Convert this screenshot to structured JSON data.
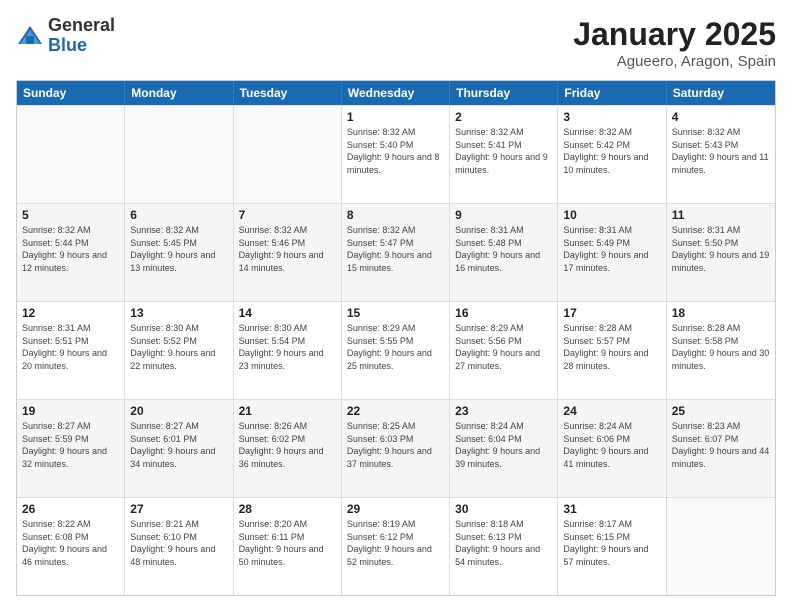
{
  "logo": {
    "general": "General",
    "blue": "Blue"
  },
  "title": "January 2025",
  "subtitle": "Agueero, Aragon, Spain",
  "days_of_week": [
    "Sunday",
    "Monday",
    "Tuesday",
    "Wednesday",
    "Thursday",
    "Friday",
    "Saturday"
  ],
  "weeks": [
    [
      {
        "day": "",
        "info": "",
        "empty": true
      },
      {
        "day": "",
        "info": "",
        "empty": true
      },
      {
        "day": "",
        "info": "",
        "empty": true
      },
      {
        "day": "1",
        "info": "Sunrise: 8:32 AM\nSunset: 5:40 PM\nDaylight: 9 hours and 8 minutes."
      },
      {
        "day": "2",
        "info": "Sunrise: 8:32 AM\nSunset: 5:41 PM\nDaylight: 9 hours and 9 minutes."
      },
      {
        "day": "3",
        "info": "Sunrise: 8:32 AM\nSunset: 5:42 PM\nDaylight: 9 hours and 10 minutes."
      },
      {
        "day": "4",
        "info": "Sunrise: 8:32 AM\nSunset: 5:43 PM\nDaylight: 9 hours and 11 minutes."
      }
    ],
    [
      {
        "day": "5",
        "info": "Sunrise: 8:32 AM\nSunset: 5:44 PM\nDaylight: 9 hours and 12 minutes."
      },
      {
        "day": "6",
        "info": "Sunrise: 8:32 AM\nSunset: 5:45 PM\nDaylight: 9 hours and 13 minutes."
      },
      {
        "day": "7",
        "info": "Sunrise: 8:32 AM\nSunset: 5:46 PM\nDaylight: 9 hours and 14 minutes."
      },
      {
        "day": "8",
        "info": "Sunrise: 8:32 AM\nSunset: 5:47 PM\nDaylight: 9 hours and 15 minutes."
      },
      {
        "day": "9",
        "info": "Sunrise: 8:31 AM\nSunset: 5:48 PM\nDaylight: 9 hours and 16 minutes."
      },
      {
        "day": "10",
        "info": "Sunrise: 8:31 AM\nSunset: 5:49 PM\nDaylight: 9 hours and 17 minutes."
      },
      {
        "day": "11",
        "info": "Sunrise: 8:31 AM\nSunset: 5:50 PM\nDaylight: 9 hours and 19 minutes."
      }
    ],
    [
      {
        "day": "12",
        "info": "Sunrise: 8:31 AM\nSunset: 5:51 PM\nDaylight: 9 hours and 20 minutes."
      },
      {
        "day": "13",
        "info": "Sunrise: 8:30 AM\nSunset: 5:52 PM\nDaylight: 9 hours and 22 minutes."
      },
      {
        "day": "14",
        "info": "Sunrise: 8:30 AM\nSunset: 5:54 PM\nDaylight: 9 hours and 23 minutes."
      },
      {
        "day": "15",
        "info": "Sunrise: 8:29 AM\nSunset: 5:55 PM\nDaylight: 9 hours and 25 minutes."
      },
      {
        "day": "16",
        "info": "Sunrise: 8:29 AM\nSunset: 5:56 PM\nDaylight: 9 hours and 27 minutes."
      },
      {
        "day": "17",
        "info": "Sunrise: 8:28 AM\nSunset: 5:57 PM\nDaylight: 9 hours and 28 minutes."
      },
      {
        "day": "18",
        "info": "Sunrise: 8:28 AM\nSunset: 5:58 PM\nDaylight: 9 hours and 30 minutes."
      }
    ],
    [
      {
        "day": "19",
        "info": "Sunrise: 8:27 AM\nSunset: 5:59 PM\nDaylight: 9 hours and 32 minutes."
      },
      {
        "day": "20",
        "info": "Sunrise: 8:27 AM\nSunset: 6:01 PM\nDaylight: 9 hours and 34 minutes."
      },
      {
        "day": "21",
        "info": "Sunrise: 8:26 AM\nSunset: 6:02 PM\nDaylight: 9 hours and 36 minutes."
      },
      {
        "day": "22",
        "info": "Sunrise: 8:25 AM\nSunset: 6:03 PM\nDaylight: 9 hours and 37 minutes."
      },
      {
        "day": "23",
        "info": "Sunrise: 8:24 AM\nSunset: 6:04 PM\nDaylight: 9 hours and 39 minutes."
      },
      {
        "day": "24",
        "info": "Sunrise: 8:24 AM\nSunset: 6:06 PM\nDaylight: 9 hours and 41 minutes."
      },
      {
        "day": "25",
        "info": "Sunrise: 8:23 AM\nSunset: 6:07 PM\nDaylight: 9 hours and 44 minutes."
      }
    ],
    [
      {
        "day": "26",
        "info": "Sunrise: 8:22 AM\nSunset: 6:08 PM\nDaylight: 9 hours and 46 minutes."
      },
      {
        "day": "27",
        "info": "Sunrise: 8:21 AM\nSunset: 6:10 PM\nDaylight: 9 hours and 48 minutes."
      },
      {
        "day": "28",
        "info": "Sunrise: 8:20 AM\nSunset: 6:11 PM\nDaylight: 9 hours and 50 minutes."
      },
      {
        "day": "29",
        "info": "Sunrise: 8:19 AM\nSunset: 6:12 PM\nDaylight: 9 hours and 52 minutes."
      },
      {
        "day": "30",
        "info": "Sunrise: 8:18 AM\nSunset: 6:13 PM\nDaylight: 9 hours and 54 minutes."
      },
      {
        "day": "31",
        "info": "Sunrise: 8:17 AM\nSunset: 6:15 PM\nDaylight: 9 hours and 57 minutes."
      },
      {
        "day": "",
        "info": "",
        "empty": true
      }
    ]
  ]
}
